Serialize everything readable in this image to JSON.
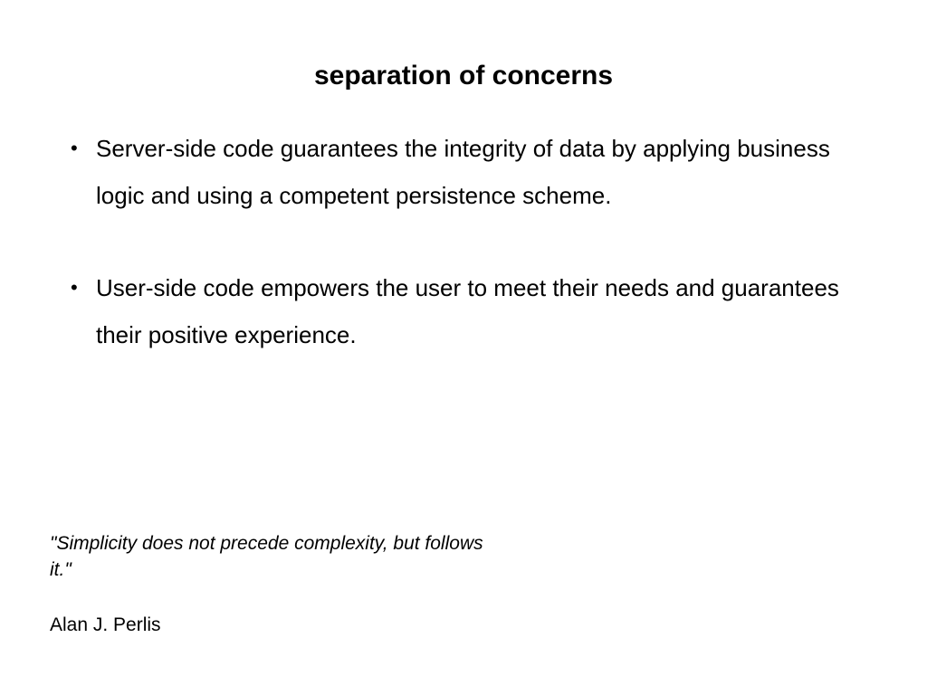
{
  "slide": {
    "title": "separation of concerns",
    "bullet_symbol": "•",
    "bullets": [
      {
        "text": "Server-side code guarantees the integrity of data by applying business logic and using a competent persistence scheme."
      },
      {
        "text": "User-side code empowers the user to meet their needs and guarantees their positive experience."
      }
    ],
    "quote": "\"Simplicity does not precede complexity, but follows it.\"",
    "author": "Alan J. Perlis"
  },
  "colors": {
    "background": "#ffffff",
    "text": "#000000"
  }
}
